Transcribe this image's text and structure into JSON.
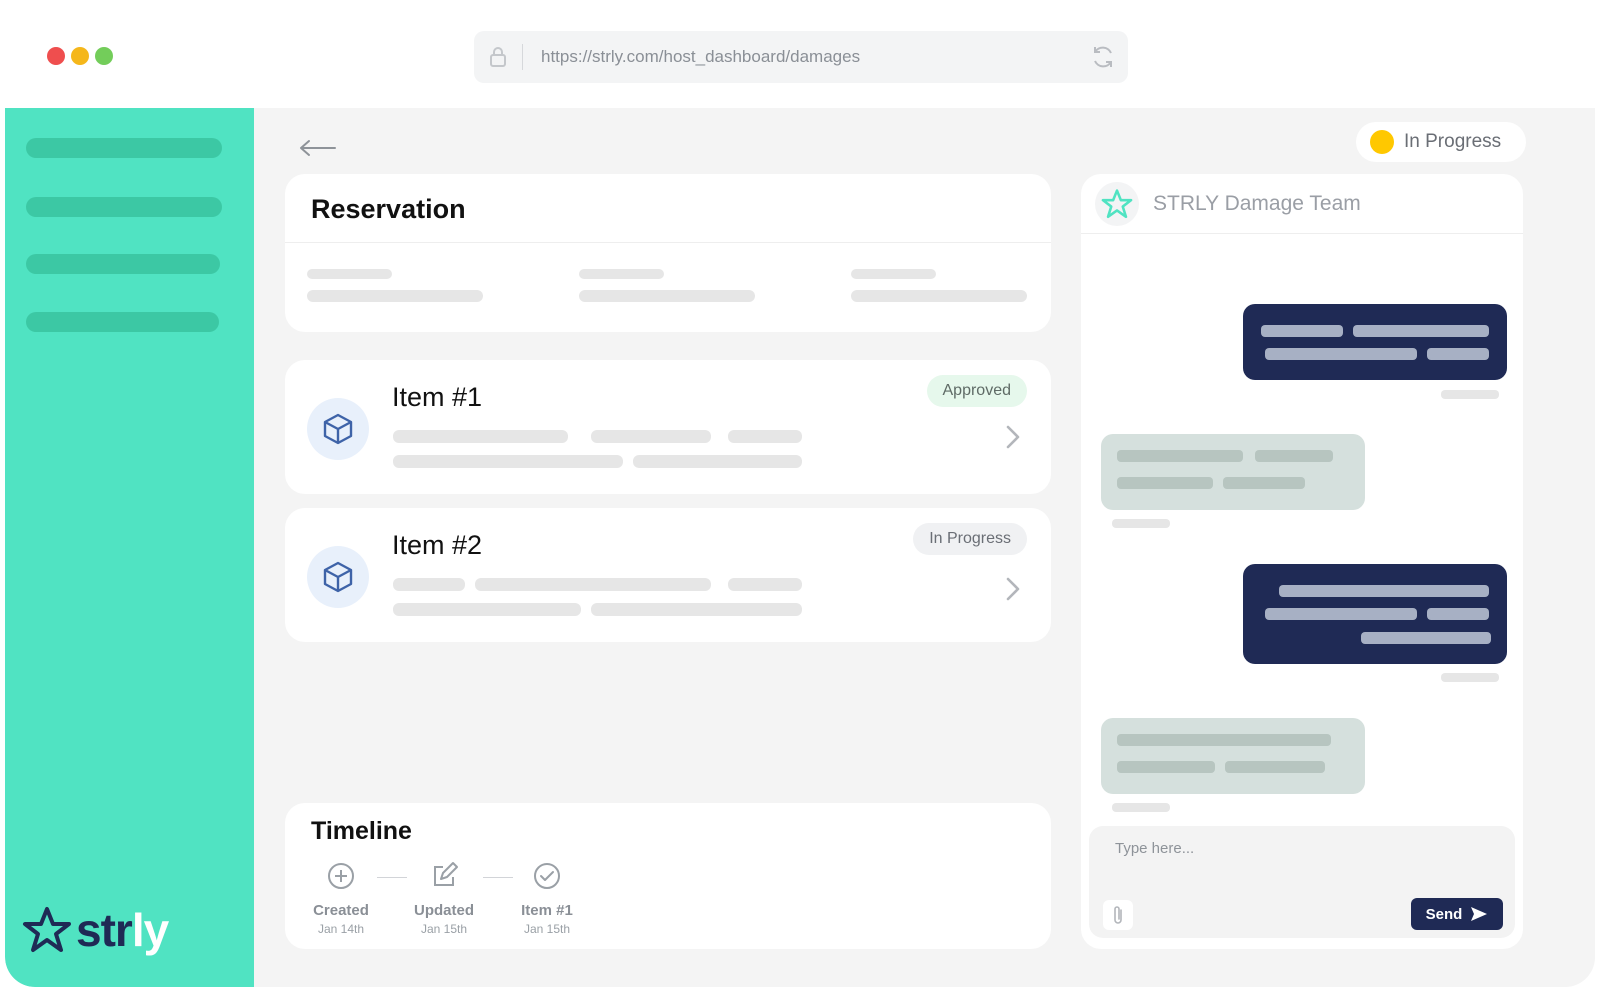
{
  "browser": {
    "url": "https://strly.com/host_dashboard/damages",
    "window_dots": [
      "#ef4e4e",
      "#f5b71b",
      "#73cd5a"
    ]
  },
  "brand": {
    "logo_text_a": "str",
    "logo_text_b": "ly",
    "accent": "#50e3c2",
    "navy": "#1f2a55"
  },
  "status": {
    "label": "In Progress",
    "color": "#ffc800"
  },
  "reservation": {
    "title": "Reservation"
  },
  "items": [
    {
      "title": "Item #1",
      "badge": "Approved",
      "badge_bg": "#e6f8ec",
      "badge_fg": "#5f6b66"
    },
    {
      "title": "Item #2",
      "badge": "In Progress",
      "badge_bg": "#f0f1f3",
      "badge_fg": "#6a6e75"
    }
  ],
  "timeline": {
    "title": "Timeline",
    "steps": [
      {
        "label": "Created",
        "date": "Jan 14th",
        "icon": "plus-circle-icon"
      },
      {
        "label": "Updated",
        "date": "Jan 15th",
        "icon": "edit-icon"
      },
      {
        "label": "Item #1",
        "date": "Jan 15th",
        "icon": "check-circle-icon"
      }
    ]
  },
  "chat": {
    "team_name": "STRLY Damage Team",
    "placeholder": "Type here...",
    "send_label": "Send"
  }
}
